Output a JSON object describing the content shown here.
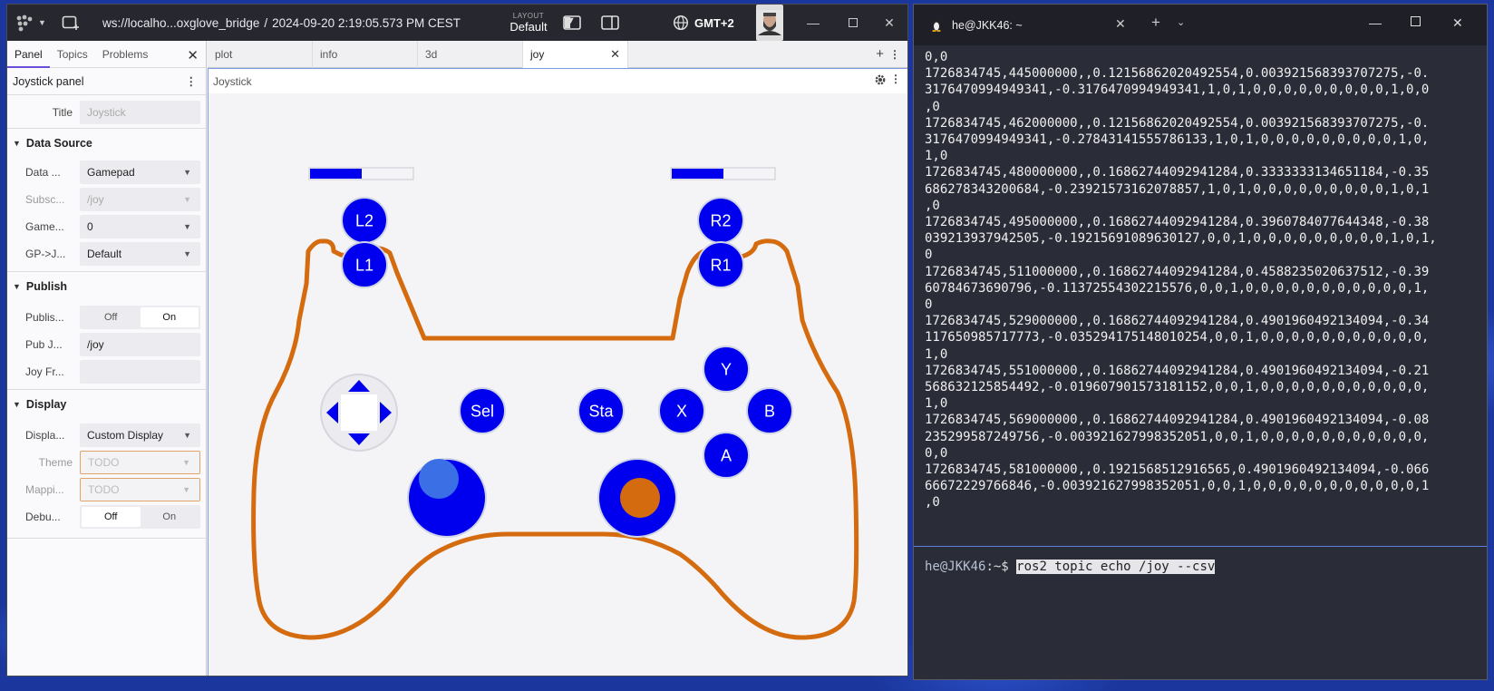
{
  "foxglove": {
    "url_label": "ws://localho...oxglove_bridge",
    "separator": "/",
    "timestamp": "2024-09-20 2:19:05.573 PM CEST",
    "layout_label": "LAYOUT",
    "layout_value": "Default",
    "timezone": "GMT+2"
  },
  "sidebar": {
    "tabs": [
      "Panel",
      "Topics",
      "Problems"
    ],
    "panel_title": "Joystick panel",
    "title_field": {
      "label": "Title",
      "placeholder": "Joystick"
    },
    "data_source": {
      "header": "Data Source",
      "rows": [
        {
          "label": "Data ...",
          "value": "Gamepad"
        },
        {
          "label": "Subsc...",
          "value": "/joy"
        },
        {
          "label": "Game...",
          "value": "0"
        },
        {
          "label": "GP->J...",
          "value": "Default"
        }
      ]
    },
    "publish": {
      "header": "Publish",
      "toggle_label": "Publis...",
      "off": "Off",
      "on": "On",
      "pub_label": "Pub J...",
      "pub_value": "/joy",
      "frame_label": "Joy Fr...",
      "frame_value": ""
    },
    "display": {
      "header": "Display",
      "display_label": "Displa...",
      "display_value": "Custom Display",
      "theme_label": "Theme",
      "theme_value": "TODO",
      "mapping_label": "Mappi...",
      "mapping_value": "TODO",
      "debug_label": "Debu...",
      "off": "Off",
      "on": "On"
    }
  },
  "tabs": [
    "plot",
    "info",
    "3d",
    "joy"
  ],
  "panel_header": "Joystick",
  "gamepad": {
    "buttons": [
      "L2",
      "R2",
      "L1",
      "R1",
      "Y",
      "X",
      "B",
      "A",
      "Sel",
      "Sta"
    ],
    "left_trigger_fill": 0.5,
    "right_trigger_fill": 0.5,
    "colors": {
      "button": "#0000ee",
      "outline": "#d46b0f"
    }
  },
  "terminal": {
    "tab_title": "he@JKK46: ~",
    "output": [
      "0,0",
      "1726834745,445000000,,0.12156862020492554,0.003921568393707275,-0.",
      "3176470994949341,-0.3176470994949341,1,0,1,0,0,0,0,0,0,0,0,0,1,0,0",
      ",0",
      "1726834745,462000000,,0.12156862020492554,0.003921568393707275,-0.",
      "3176470994949341,-0.27843141555786133,1,0,1,0,0,0,0,0,0,0,0,0,1,0,",
      "1,0",
      "1726834745,480000000,,0.16862744092941284,0.3333333134651184,-0.35",
      "686278343200684,-0.23921573162078857,1,0,1,0,0,0,0,0,0,0,0,0,1,0,1",
      ",0",
      "1726834745,495000000,,0.16862744092941284,0.3960784077644348,-0.38",
      "039213937942505,-0.19215691089630127,0,0,1,0,0,0,0,0,0,0,0,0,1,0,1,",
      "0",
      "1726834745,511000000,,0.16862744092941284,0.4588235020637512,-0.39",
      "60784673690796,-0.11372554302215576,0,0,1,0,0,0,0,0,0,0,0,0,0,0,1,",
      "0",
      "1726834745,529000000,,0.16862744092941284,0.4901960492134094,-0.34",
      "117650985717773,-0.035294175148010254,0,0,1,0,0,0,0,0,0,0,0,0,0,0,",
      "1,0",
      "1726834745,551000000,,0.16862744092941284,0.4901960492134094,-0.21",
      "568632125854492,-0.019607901573181152,0,0,1,0,0,0,0,0,0,0,0,0,0,0,",
      "1,0",
      "1726834745,569000000,,0.16862744092941284,0.4901960492134094,-0.08",
      "235299587249756,-0.003921627998352051,0,0,1,0,0,0,0,0,0,0,0,0,0,0,",
      "0,0",
      "1726834745,581000000,,0.1921568512916565,0.4901960492134094,-0.066",
      "66672229766846,-0.003921627998352051,0,0,1,0,0,0,0,0,0,0,0,0,0,0,1",
      ",0"
    ],
    "prompt_user": "he@JKK46",
    "prompt_path": ":~$ ",
    "command": "ros2 topic echo /joy --csv"
  }
}
